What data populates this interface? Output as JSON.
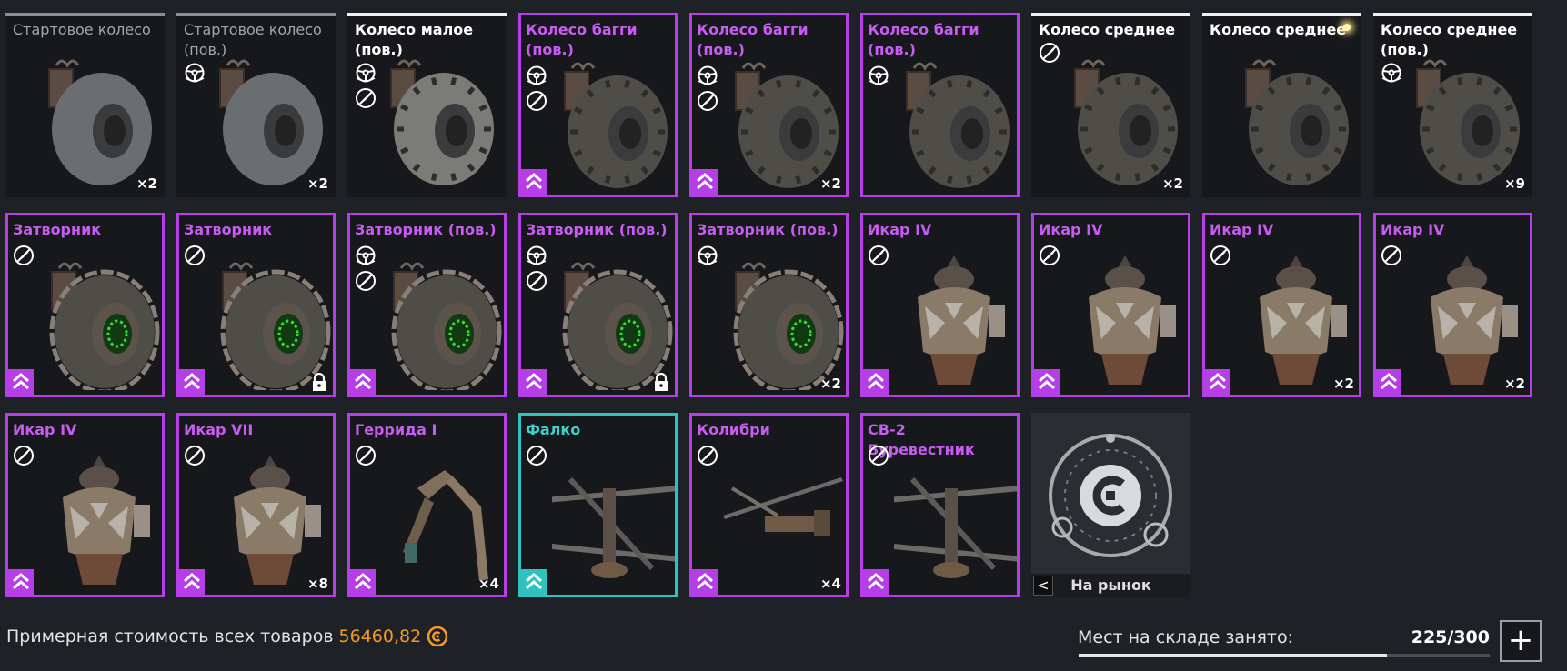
{
  "colors": {
    "background": "#1e2126",
    "rarity_common": "#8c8e91",
    "rarity_rare": "#f2f2f2",
    "rarity_epic": "#b53ee6",
    "rarity_special": "#2fc3c0",
    "price": "#f29b26"
  },
  "items": [
    {
      "name": "Стартовое колесо",
      "rarity": "grey",
      "kind": "wheel-plain",
      "icons": [],
      "count": "×2",
      "upgrade": false,
      "lock": false
    },
    {
      "name": "Стартовое колесо (пов.)",
      "rarity": "grey",
      "kind": "wheel-plain",
      "icons": [
        "steering-wheel-icon"
      ],
      "count": "×2",
      "upgrade": false,
      "lock": false
    },
    {
      "name": "Колесо малое (пов.)",
      "rarity": "white",
      "kind": "wheel-small",
      "icons": [
        "steering-wheel-icon",
        "no-paint-icon"
      ],
      "count": "",
      "upgrade": false,
      "lock": false
    },
    {
      "name": "Колесо багги (пов.)",
      "rarity": "purple",
      "kind": "wheel-buggy",
      "icons": [
        "steering-wheel-icon",
        "no-paint-icon"
      ],
      "count": "",
      "upgrade": true,
      "lock": false
    },
    {
      "name": "Колесо багги (пов.)",
      "rarity": "purple",
      "kind": "wheel-buggy",
      "icons": [
        "steering-wheel-icon",
        "no-paint-icon"
      ],
      "count": "×2",
      "upgrade": true,
      "lock": false
    },
    {
      "name": "Колесо багги (пов.)",
      "rarity": "purple",
      "kind": "wheel-buggy",
      "icons": [
        "steering-wheel-icon"
      ],
      "count": "",
      "upgrade": false,
      "lock": false
    },
    {
      "name": "Колесо среднее",
      "rarity": "white",
      "kind": "wheel-tractor",
      "icons": [
        "no-paint-icon"
      ],
      "count": "×2",
      "upgrade": false,
      "lock": false
    },
    {
      "name": "Колесо среднее",
      "rarity": "white",
      "kind": "wheel-tractor",
      "icons": [],
      "count": "",
      "upgrade": false,
      "lock": false,
      "new": true
    },
    {
      "name": "Колесо среднее (пов.)",
      "rarity": "white",
      "kind": "wheel-tractor",
      "icons": [
        "steering-wheel-icon"
      ],
      "count": "×9",
      "upgrade": false,
      "lock": false
    },
    {
      "name": "Затворник",
      "rarity": "purple",
      "kind": "wheel-hermit",
      "icons": [
        "no-paint-icon"
      ],
      "count": "",
      "upgrade": true,
      "lock": false
    },
    {
      "name": "Затворник",
      "rarity": "purple",
      "kind": "wheel-hermit",
      "icons": [
        "no-paint-icon"
      ],
      "count": "",
      "upgrade": true,
      "lock": true
    },
    {
      "name": "Затворник (пов.)",
      "rarity": "purple",
      "kind": "wheel-hermit",
      "icons": [
        "steering-wheel-icon",
        "no-paint-icon"
      ],
      "count": "",
      "upgrade": true,
      "lock": false
    },
    {
      "name": "Затворник (пов.)",
      "rarity": "purple",
      "kind": "wheel-hermit",
      "icons": [
        "steering-wheel-icon",
        "no-paint-icon"
      ],
      "count": "",
      "upgrade": true,
      "lock": true
    },
    {
      "name": "Затворник (пов.)",
      "rarity": "purple",
      "kind": "wheel-hermit",
      "icons": [
        "steering-wheel-icon"
      ],
      "count": "×2",
      "upgrade": false,
      "lock": false
    },
    {
      "name": "Икар IV",
      "rarity": "purple",
      "kind": "thruster",
      "icons": [
        "no-paint-icon"
      ],
      "count": "",
      "upgrade": true,
      "lock": false
    },
    {
      "name": "Икар IV",
      "rarity": "purple",
      "kind": "thruster",
      "icons": [
        "no-paint-icon"
      ],
      "count": "",
      "upgrade": true,
      "lock": false
    },
    {
      "name": "Икар IV",
      "rarity": "purple",
      "kind": "thruster",
      "icons": [
        "no-paint-icon"
      ],
      "count": "×2",
      "upgrade": true,
      "lock": false
    },
    {
      "name": "Икар IV",
      "rarity": "purple",
      "kind": "thruster",
      "icons": [
        "no-paint-icon"
      ],
      "count": "×2",
      "upgrade": true,
      "lock": false
    },
    {
      "name": "Икар IV",
      "rarity": "purple",
      "kind": "thruster",
      "icons": [
        "no-paint-icon"
      ],
      "count": "",
      "upgrade": true,
      "lock": false
    },
    {
      "name": "Икар VII",
      "rarity": "purple",
      "kind": "thruster",
      "icons": [
        "no-paint-icon"
      ],
      "count": "×8",
      "upgrade": true,
      "lock": false
    },
    {
      "name": "Геррида I",
      "rarity": "purple",
      "kind": "leg",
      "icons": [
        "no-paint-icon"
      ],
      "count": "×4",
      "upgrade": true,
      "lock": false
    },
    {
      "name": "Фалко",
      "rarity": "teal",
      "kind": "rotor",
      "icons": [
        "no-paint-icon"
      ],
      "count": "",
      "upgrade": true,
      "lock": false
    },
    {
      "name": "Колибри",
      "rarity": "purple",
      "kind": "rotor-small",
      "icons": [
        "no-paint-icon"
      ],
      "count": "×4",
      "upgrade": true,
      "lock": false
    },
    {
      "name": "СВ-2 Буревестник",
      "rarity": "purple",
      "kind": "rotor",
      "icons": [
        "no-paint-icon"
      ],
      "count": "",
      "upgrade": true,
      "lock": false
    }
  ],
  "market": {
    "label": "На рынок",
    "back": "<"
  },
  "footer": {
    "total_label": "Примерная стоимость всех товаров",
    "total_value": "56460,82",
    "storage_label": "Мест на складе занято:",
    "storage_count": "225/300",
    "storage_fraction": 0.75,
    "add_label": "+"
  }
}
